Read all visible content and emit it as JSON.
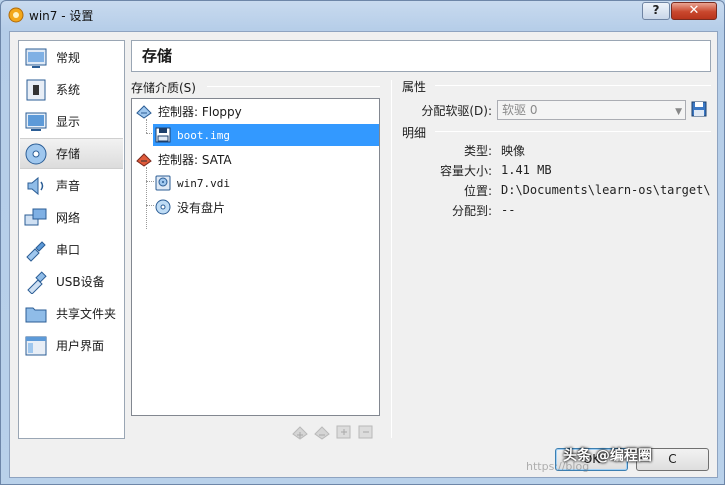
{
  "window": {
    "title": "win7 - 设置",
    "help_label": "?",
    "close_label": "✕"
  },
  "sidebar": {
    "items": [
      {
        "label": "常规",
        "icon": "general-icon"
      },
      {
        "label": "系统",
        "icon": "system-icon"
      },
      {
        "label": "显示",
        "icon": "display-icon"
      },
      {
        "label": "存储",
        "icon": "storage-icon",
        "selected": true
      },
      {
        "label": "声音",
        "icon": "audio-icon"
      },
      {
        "label": "网络",
        "icon": "network-icon"
      },
      {
        "label": "串口",
        "icon": "serial-port-icon"
      },
      {
        "label": "USB设备",
        "icon": "usb-icon"
      },
      {
        "label": "共享文件夹",
        "icon": "shared-folder-icon"
      },
      {
        "label": "用户界面",
        "icon": "user-interface-icon"
      }
    ]
  },
  "page": {
    "title": "存储"
  },
  "storage": {
    "label": "存储介质(S)",
    "tree": {
      "controller_floppy": "控制器: Floppy",
      "floppy_image": "boot.img",
      "controller_sata": "控制器: SATA",
      "sata_disk": "win7.vdi",
      "sata_empty": "没有盘片"
    }
  },
  "attributes": {
    "label": "属性",
    "drive_label": "分配软驱(D):",
    "drive_value": "软驱 0"
  },
  "details": {
    "label": "明细",
    "type_label": "类型:",
    "type_value": "映像",
    "size_label": "容量大小:",
    "size_value": "1.41 MB",
    "location_label": "位置:",
    "location_value": "D:\\Documents\\learn-os\\target\\boo…",
    "attached_label": "分配到:",
    "attached_value": "--"
  },
  "buttons": {
    "ok": "OK",
    "cancel": "C"
  },
  "watermark": {
    "text": "头条 @编程圈",
    "url": "https://blog"
  },
  "colors": {
    "selection": "#3399ff",
    "dialog_bg": "#f0f0f0",
    "title_bg": "#b9d1ea"
  }
}
